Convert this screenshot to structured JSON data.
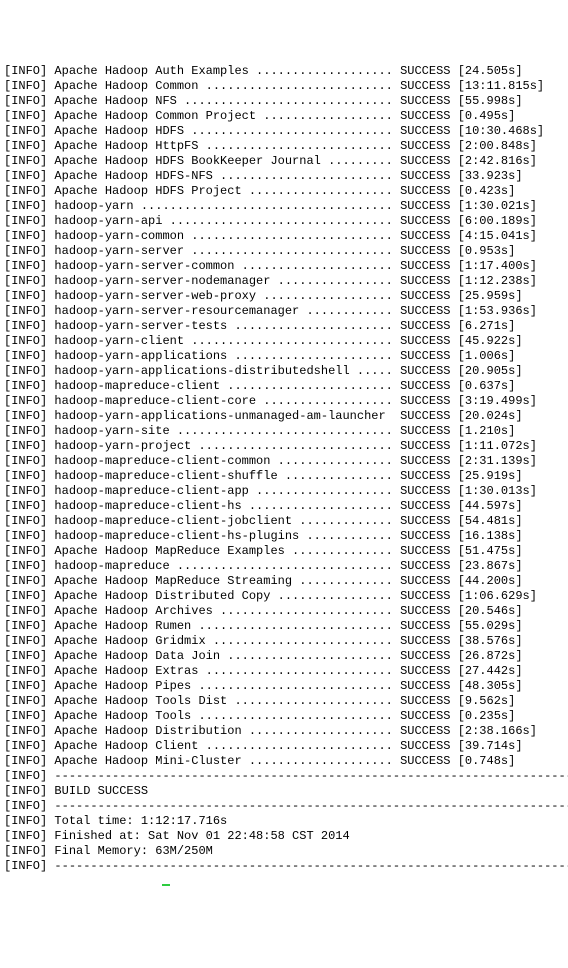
{
  "tag": "[INFO]",
  "status_label": "SUCCESS",
  "separator": "------------------------------------------------------------------------",
  "modules": [
    {
      "name": "Apache Hadoop Auth Examples",
      "time": "24.505s"
    },
    {
      "name": "Apache Hadoop Common",
      "time": "13:11.815s"
    },
    {
      "name": "Apache Hadoop NFS",
      "time": "55.998s"
    },
    {
      "name": "Apache Hadoop Common Project",
      "time": "0.495s"
    },
    {
      "name": "Apache Hadoop HDFS",
      "time": "10:30.468s"
    },
    {
      "name": "Apache Hadoop HttpFS",
      "time": "2:00.848s"
    },
    {
      "name": "Apache Hadoop HDFS BookKeeper Journal",
      "time": "2:42.816s"
    },
    {
      "name": "Apache Hadoop HDFS-NFS",
      "time": "33.923s"
    },
    {
      "name": "Apache Hadoop HDFS Project",
      "time": "0.423s"
    },
    {
      "name": "hadoop-yarn",
      "time": "1:30.021s"
    },
    {
      "name": "hadoop-yarn-api",
      "time": "6:00.189s"
    },
    {
      "name": "hadoop-yarn-common",
      "time": "4:15.041s"
    },
    {
      "name": "hadoop-yarn-server",
      "time": "0.953s"
    },
    {
      "name": "hadoop-yarn-server-common",
      "time": "1:17.400s"
    },
    {
      "name": "hadoop-yarn-server-nodemanager",
      "time": "1:12.238s"
    },
    {
      "name": "hadoop-yarn-server-web-proxy",
      "time": "25.959s"
    },
    {
      "name": "hadoop-yarn-server-resourcemanager",
      "time": "1:53.936s"
    },
    {
      "name": "hadoop-yarn-server-tests",
      "time": "6.271s"
    },
    {
      "name": "hadoop-yarn-client",
      "time": "45.922s"
    },
    {
      "name": "hadoop-yarn-applications",
      "time": "1.006s"
    },
    {
      "name": "hadoop-yarn-applications-distributedshell",
      "time": "20.905s"
    },
    {
      "name": "hadoop-mapreduce-client",
      "time": "0.637s"
    },
    {
      "name": "hadoop-mapreduce-client-core",
      "time": "3:19.499s"
    },
    {
      "name": "hadoop-yarn-applications-unmanaged-am-launcher",
      "time": "20.024s"
    },
    {
      "name": "hadoop-yarn-site",
      "time": "1.210s"
    },
    {
      "name": "hadoop-yarn-project",
      "time": "1:11.072s"
    },
    {
      "name": "hadoop-mapreduce-client-common",
      "time": "2:31.139s"
    },
    {
      "name": "hadoop-mapreduce-client-shuffle",
      "time": "25.919s"
    },
    {
      "name": "hadoop-mapreduce-client-app",
      "time": "1:30.013s"
    },
    {
      "name": "hadoop-mapreduce-client-hs",
      "time": "44.597s"
    },
    {
      "name": "hadoop-mapreduce-client-jobclient",
      "time": "54.481s"
    },
    {
      "name": "hadoop-mapreduce-client-hs-plugins",
      "time": "16.138s"
    },
    {
      "name": "Apache Hadoop MapReduce Examples",
      "time": "51.475s"
    },
    {
      "name": "hadoop-mapreduce",
      "time": "23.867s"
    },
    {
      "name": "Apache Hadoop MapReduce Streaming",
      "time": "44.200s"
    },
    {
      "name": "Apache Hadoop Distributed Copy",
      "time": "1:06.629s"
    },
    {
      "name": "Apache Hadoop Archives",
      "time": "20.546s"
    },
    {
      "name": "Apache Hadoop Rumen",
      "time": "55.029s"
    },
    {
      "name": "Apache Hadoop Gridmix",
      "time": "38.576s"
    },
    {
      "name": "Apache Hadoop Data Join",
      "time": "26.872s"
    },
    {
      "name": "Apache Hadoop Extras",
      "time": "27.442s"
    },
    {
      "name": "Apache Hadoop Pipes",
      "time": "48.305s"
    },
    {
      "name": "Apache Hadoop Tools Dist",
      "time": "9.562s"
    },
    {
      "name": "Apache Hadoop Tools",
      "time": "0.235s"
    },
    {
      "name": "Apache Hadoop Distribution",
      "time": "2:38.166s"
    },
    {
      "name": "Apache Hadoop Client",
      "time": "39.714s"
    },
    {
      "name": "Apache Hadoop Mini-Cluster",
      "time": "0.748s"
    }
  ],
  "summary": {
    "build_status": "BUILD SUCCESS",
    "total_time_label": "Total time:",
    "total_time": "1:12:17.716s",
    "finished_label": "Finished at:",
    "finished_at": "Sat Nov 01 22:48:58 CST 2014",
    "memory_label": "Final Memory:",
    "memory": "63M/250M"
  },
  "layout": {
    "name_col_width": 47,
    "status_col_start": 54
  }
}
